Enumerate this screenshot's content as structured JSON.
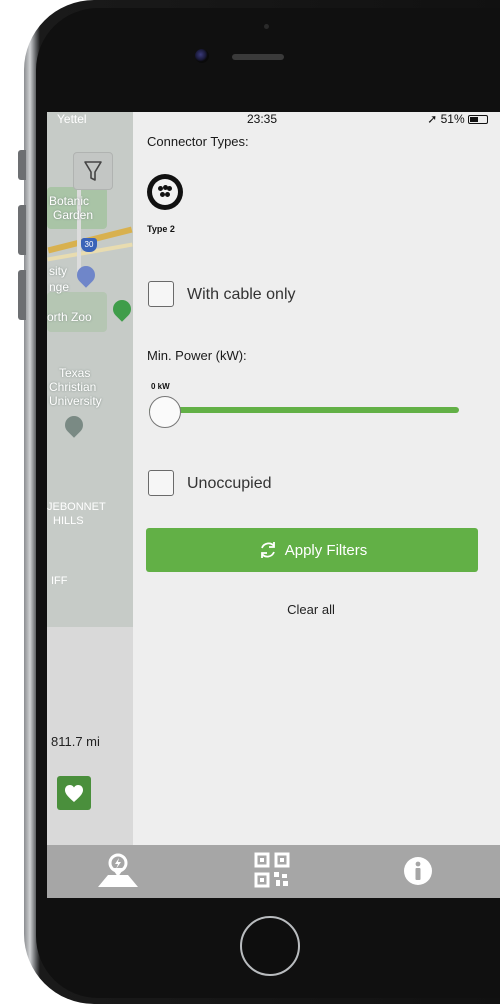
{
  "status_bar": {
    "carrier": "Yettel",
    "time": "23:35",
    "battery": "51%"
  },
  "map": {
    "labels": [
      "Botanic",
      "Garden",
      "sity",
      "nge",
      "orth Zoo",
      "Texas",
      "Christian",
      "University",
      "JEBONNET",
      "HILLS",
      "IFF"
    ],
    "highway_shield": "30",
    "distance": "811.7 mi"
  },
  "filters": {
    "connector_types_label": "Connector Types:",
    "connector_name": "Type 2",
    "with_cable_label": "With cable only",
    "min_power_label": "Min. Power (kW):",
    "min_power_value": "0 kW",
    "min_power_slider_fraction": 0,
    "unoccupied_label": "Unoccupied",
    "apply_label": "Apply Filters",
    "clear_label": "Clear all"
  },
  "tabs": [
    {
      "icon": "map-pin-icon"
    },
    {
      "icon": "qr-code-icon"
    },
    {
      "icon": "info-icon"
    }
  ],
  "colors": {
    "accent": "#62b046",
    "heart_button": "#4a8f3c",
    "tabbar": "#a6a6a6"
  }
}
